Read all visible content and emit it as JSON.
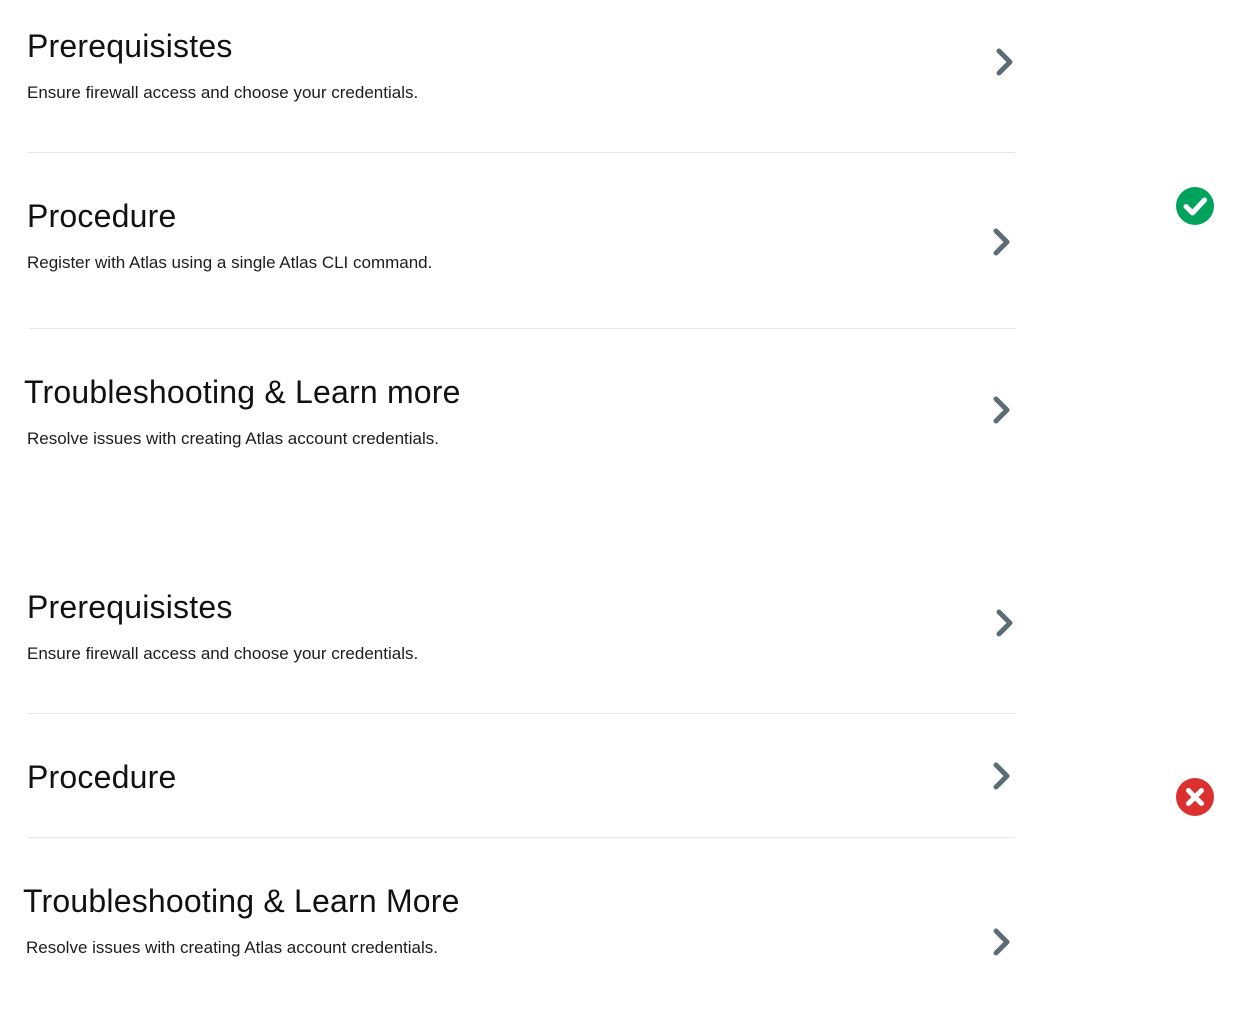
{
  "examples": {
    "good": {
      "status_icon": "check-circle-icon",
      "status_color": "#00A35C",
      "items": [
        {
          "title": "Prerequisistes",
          "description": "Ensure firewall access and choose your credentials."
        },
        {
          "title": "Procedure",
          "description": "Register with Atlas using a single Atlas CLI command."
        },
        {
          "title": "Troubleshooting & Learn more",
          "description": "Resolve issues with creating Atlas account credentials."
        }
      ]
    },
    "bad": {
      "status_icon": "x-circle-icon",
      "status_color": "#DB3030",
      "items": [
        {
          "title": "Prerequisistes",
          "description": "Ensure firewall access and choose your credentials."
        },
        {
          "title": "Procedure"
        },
        {
          "title": "Troubleshooting & Learn More",
          "description": "Resolve issues with creating Atlas account credentials."
        }
      ]
    }
  },
  "colors": {
    "chevron": "#5C6C75",
    "divider": "#E4E6E7"
  },
  "icons": {
    "chevron": "chevron-right-icon"
  }
}
